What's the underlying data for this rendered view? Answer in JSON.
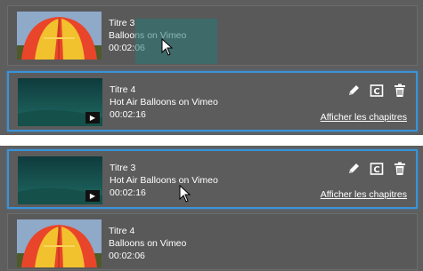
{
  "top_list": {
    "items": [
      {
        "title": "Titre 3",
        "name": "Balloons on Vimeo",
        "duration": "00:02:06",
        "thumb": "balloon"
      },
      {
        "title": "Titre 4",
        "name": "Hot Air Balloons on Vimeo",
        "duration": "00:02:16",
        "thumb": "teal",
        "chapters_link": "Afficher les chapitres"
      }
    ]
  },
  "bottom_list": {
    "items": [
      {
        "title": "Titre 3",
        "name": "Hot Air Balloons on Vimeo",
        "duration": "00:02:16",
        "thumb": "teal",
        "chapters_link": "Afficher les chapitres"
      },
      {
        "title": "Titre 4",
        "name": "Balloons on Vimeo",
        "duration": "00:02:06",
        "thumb": "balloon"
      }
    ]
  },
  "icons": [
    "edit-pencil-icon",
    "chapter-c-icon",
    "delete-trash-icon",
    "play-icon",
    "mouse-cursor-icon"
  ],
  "colors": {
    "panel": "#5e5e5e",
    "item": "#595959",
    "selection": "#3a93d8",
    "text": "#ffffff"
  }
}
